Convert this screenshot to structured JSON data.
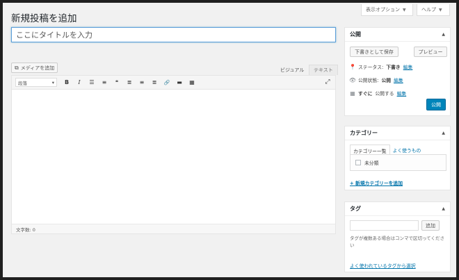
{
  "screen_options": {
    "label": "表示オプション",
    "caret": "▼"
  },
  "help": {
    "label": "ヘルプ",
    "caret": "▼"
  },
  "page": {
    "title": "新規投稿を追加"
  },
  "title_field": {
    "placeholder": "ここにタイトルを入力"
  },
  "media": {
    "add_label": "メディアを追加"
  },
  "editor_tabs": {
    "visual": "ビジュアル",
    "text": "テキスト"
  },
  "toolbar": {
    "format_select": "段落",
    "format_caret": "▾",
    "buttons": [
      {
        "name": "bold-button",
        "glyph": "B"
      },
      {
        "name": "italic-button",
        "glyph": "I"
      },
      {
        "name": "bullet-list-button",
        "glyph": "☰"
      },
      {
        "name": "numbered-list-button",
        "glyph": "≡"
      },
      {
        "name": "blockquote-button",
        "glyph": "❝"
      },
      {
        "name": "align-left-button",
        "glyph": "≣"
      },
      {
        "name": "align-center-button",
        "glyph": "≡"
      },
      {
        "name": "align-right-button",
        "glyph": "≣"
      },
      {
        "name": "insert-link-button",
        "glyph": "🔗"
      },
      {
        "name": "read-more-button",
        "glyph": "▬"
      },
      {
        "name": "toolbar-toggle-button",
        "glyph": "▦"
      }
    ],
    "fullscreen_glyph": "⤢"
  },
  "word_count": {
    "label": "文字数: 0"
  },
  "publish_box": {
    "title": "公開",
    "toggle": "▲",
    "save_draft": "下書きとして保存",
    "preview": "プレビュー",
    "status_label": "ステータス: ",
    "status_value": "下書き",
    "visibility_label": "公開状態: ",
    "visibility_value": "公開",
    "schedule_value": "すぐに",
    "schedule_suffix": "公開する",
    "edit": "編集",
    "publish": "公開"
  },
  "category_box": {
    "title": "カテゴリー",
    "toggle": "▲",
    "tab_all": "カテゴリー一覧",
    "tab_popular": "よく使うもの",
    "item": "未分類",
    "add_new": "+ 新規カテゴリーを追加"
  },
  "tag_box": {
    "title": "タグ",
    "toggle": "▲",
    "add_button": "追加",
    "hint": "タグが複数ある場合はコンマで区切ってください",
    "popular_link": "よく使われているタグから選択"
  },
  "colors": {
    "accent": "#0085ba",
    "link": "#0073aa",
    "focus_border": "#5b9dd9"
  }
}
